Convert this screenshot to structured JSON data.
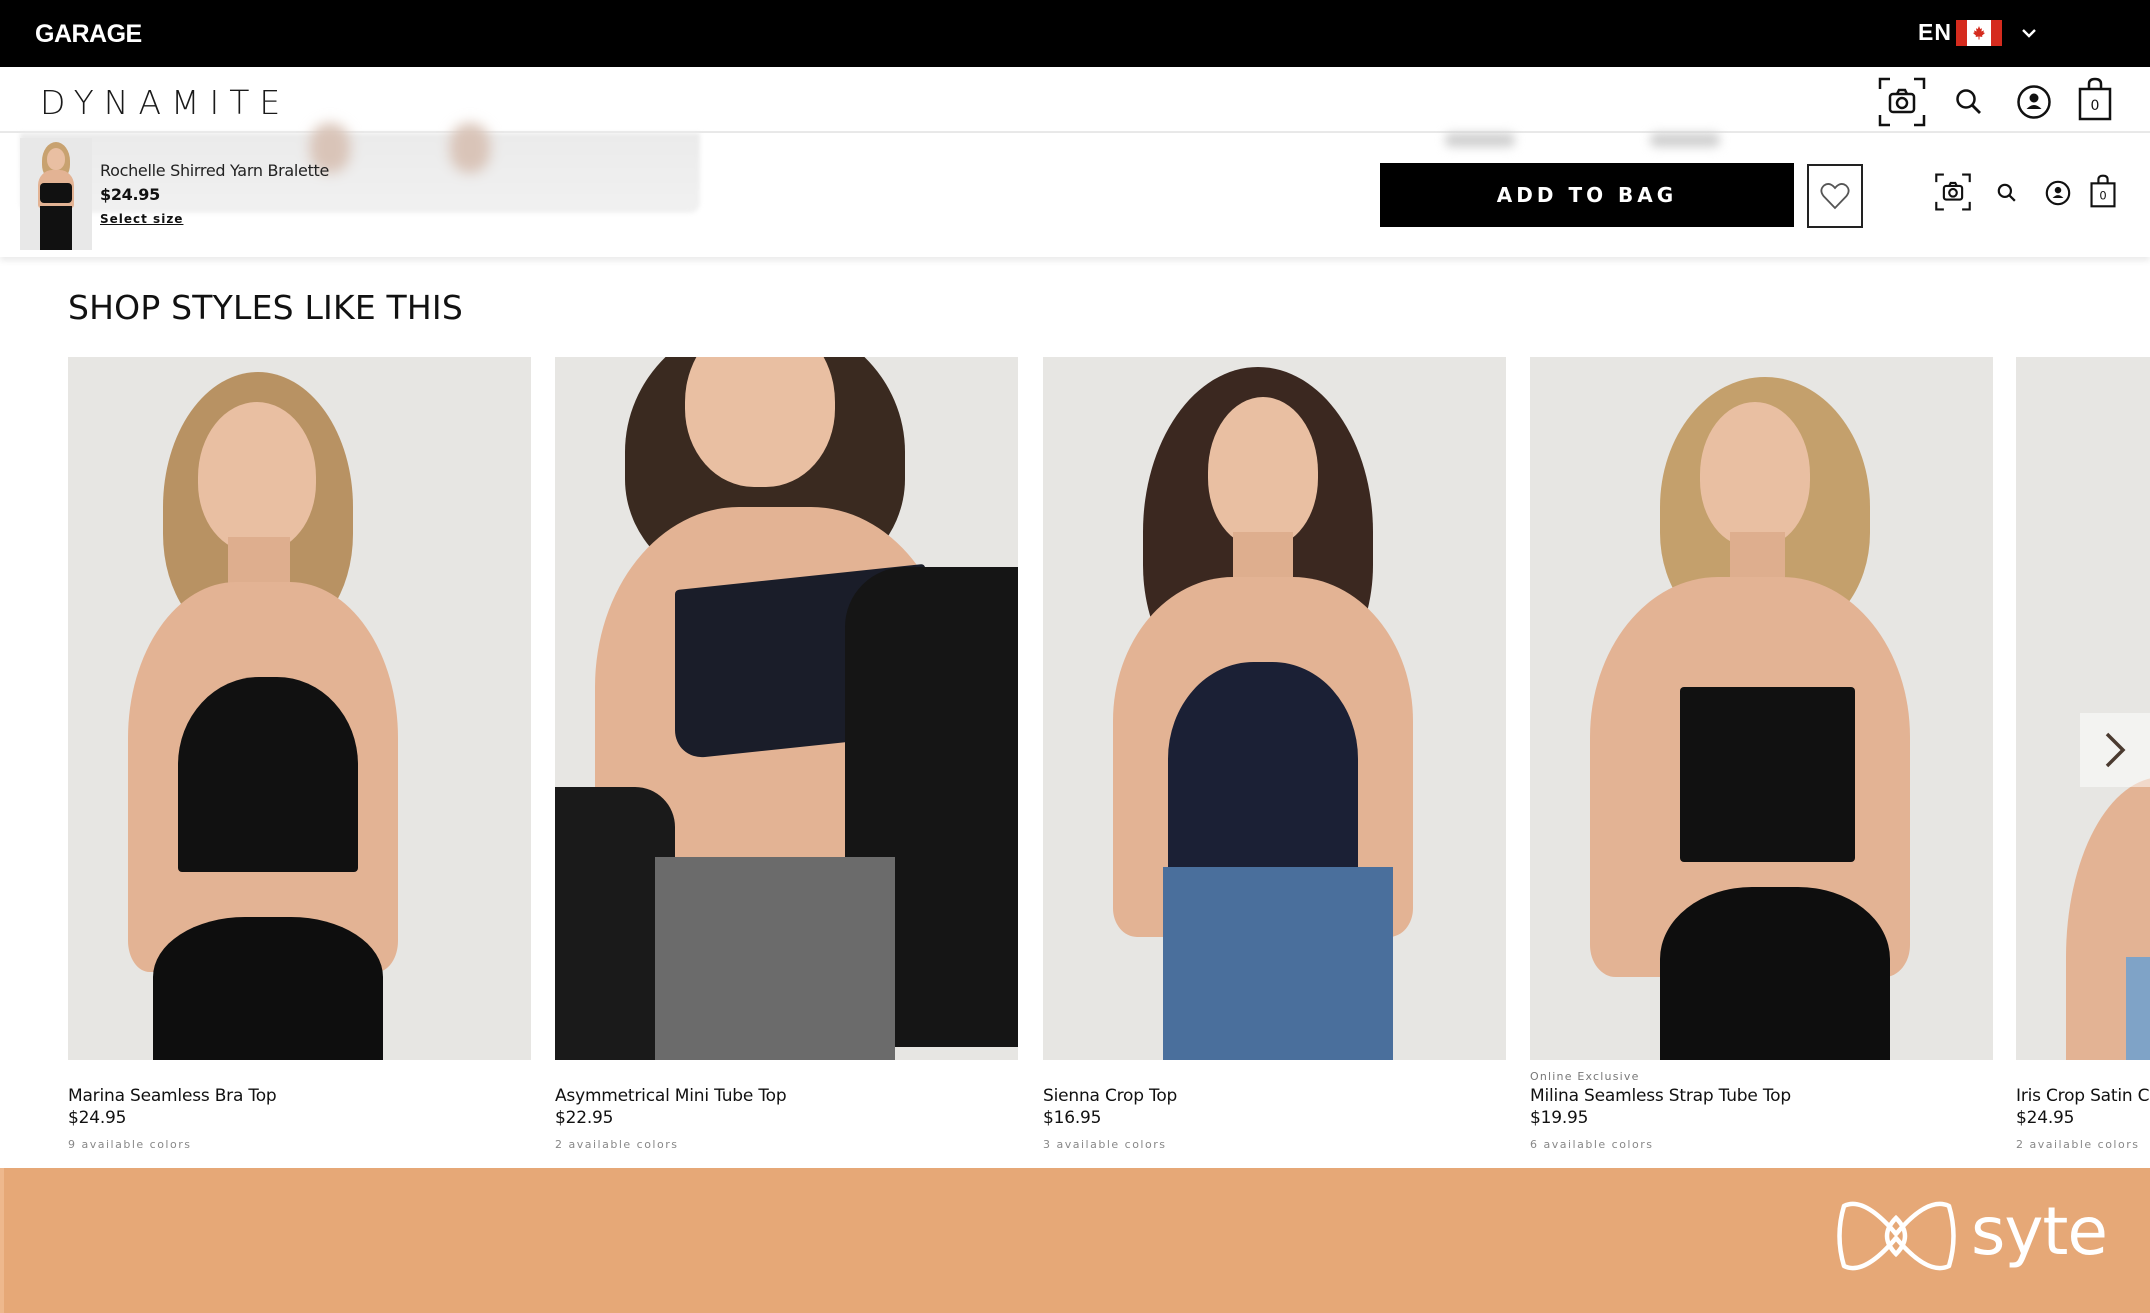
{
  "topbar": {
    "brand_logo": "GARAGE",
    "language": {
      "code": "EN",
      "flag": "canada-flag-icon",
      "chevron": "chevron-down-icon"
    }
  },
  "header": {
    "brand_logo": "DYNAMITE",
    "icons": [
      "visual-search-camera-icon",
      "search-icon",
      "account-icon",
      "shopping-bag-icon"
    ],
    "bag_count": "0"
  },
  "sticky_bar": {
    "product_name": "Rochelle Shirred Yarn Bralette",
    "price": "$24.95",
    "select_size_label": "Select size",
    "add_to_bag_label": "ADD TO BAG",
    "wishlist_icon": "heart-icon",
    "bag_count": "0"
  },
  "recommendations": {
    "title": "SHOP STYLES LIKE THIS",
    "products": [
      {
        "badge": "",
        "name": "Marina Seamless Bra Top",
        "price": "$24.95",
        "colors": "9 available colors"
      },
      {
        "badge": "",
        "name": "Asymmetrical Mini Tube Top",
        "price": "$22.95",
        "colors": "2 available colors"
      },
      {
        "badge": "",
        "name": "Sienna Crop Top",
        "price": "$16.95",
        "colors": "3 available colors"
      },
      {
        "badge": "Online Exclusive",
        "name": "Milina Seamless Strap Tube Top",
        "price": "$19.95",
        "colors": "6 available colors"
      },
      {
        "badge": "",
        "name": "Iris Crop Satin Cami",
        "price": "$24.95",
        "colors": "2 available colors"
      }
    ],
    "next_icon": "chevron-right-icon"
  },
  "banner": {
    "brand": "syte",
    "background": "#E6A877"
  }
}
